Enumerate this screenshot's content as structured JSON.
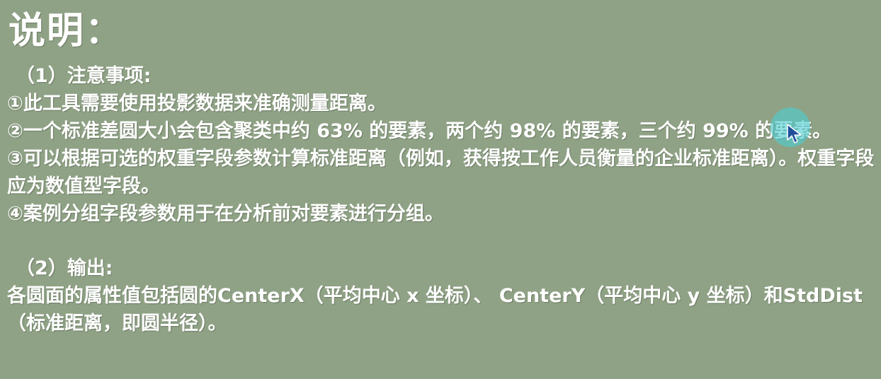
{
  "slide": {
    "title": "说明：",
    "notes_heading": "（1）注意事项:",
    "note_1": "①此工具需要使用投影数据来准确测量距离。",
    "note_2": "②一个标准差圆大小会包含聚类中约 63% 的要素，两个约 98% 的要素，三个约 99% 的要素。",
    "note_3": "③可以根据可选的权重字段参数计算标准距离（例如，获得按工作人员衡量的企业标准距离）。权重字段应为数值型字段。",
    "note_4": "④案例分组字段参数用于在分析前对要素进行分组。",
    "output_heading": "（2）输出:",
    "output_text": "各圆面的属性值包括圆的CenterX（平均中心 x 坐标）、 CenterY（平均中心 y 坐标）和StdDist（标准距离，即圆半径）。"
  },
  "colors": {
    "background": "#8fa285",
    "text": "#ffffff",
    "cursor_highlight": "#4ecdd2",
    "cursor_arrow": "#1f4f9a"
  },
  "icons": {
    "cursor": "mouse-pointer-icon"
  }
}
